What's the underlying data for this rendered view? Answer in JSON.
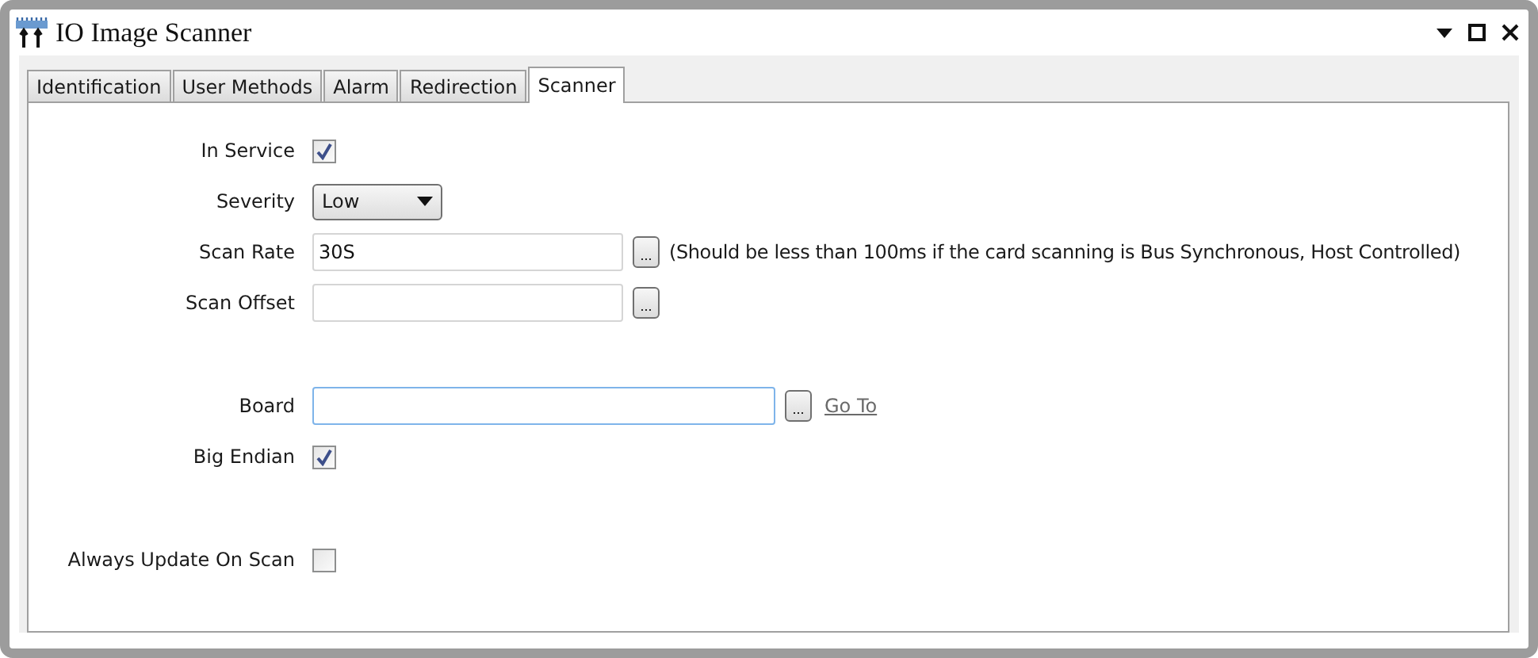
{
  "window": {
    "title": "IO Image Scanner"
  },
  "tabs": [
    {
      "label": "Identification",
      "selected": false
    },
    {
      "label": "User Methods",
      "selected": false
    },
    {
      "label": "Alarm",
      "selected": false
    },
    {
      "label": "Redirection",
      "selected": false
    },
    {
      "label": "Scanner",
      "selected": true
    }
  ],
  "sections": [
    [
      {
        "kind": "checkbox",
        "label": "In Service",
        "checked": true
      },
      {
        "kind": "dropdown",
        "label": "Severity",
        "value": "Low"
      },
      {
        "kind": "text",
        "label": "Scan Rate",
        "value": "30S",
        "focused": false,
        "browse": "...",
        "note": "(Should be less than 100ms if the card scanning is Bus Synchronous, Host Controlled)"
      },
      {
        "kind": "text",
        "label": "Scan Offset",
        "focused": false,
        "browse": "..."
      }
    ],
    [
      {
        "kind": "text",
        "label": "Board",
        "focused": true,
        "browse": "...",
        "link": "Go To"
      },
      {
        "kind": "checkbox",
        "label": "Big Endian",
        "checked": true
      }
    ],
    [
      {
        "kind": "checkbox",
        "label": "Always Update On Scan",
        "checked": false
      }
    ]
  ]
}
